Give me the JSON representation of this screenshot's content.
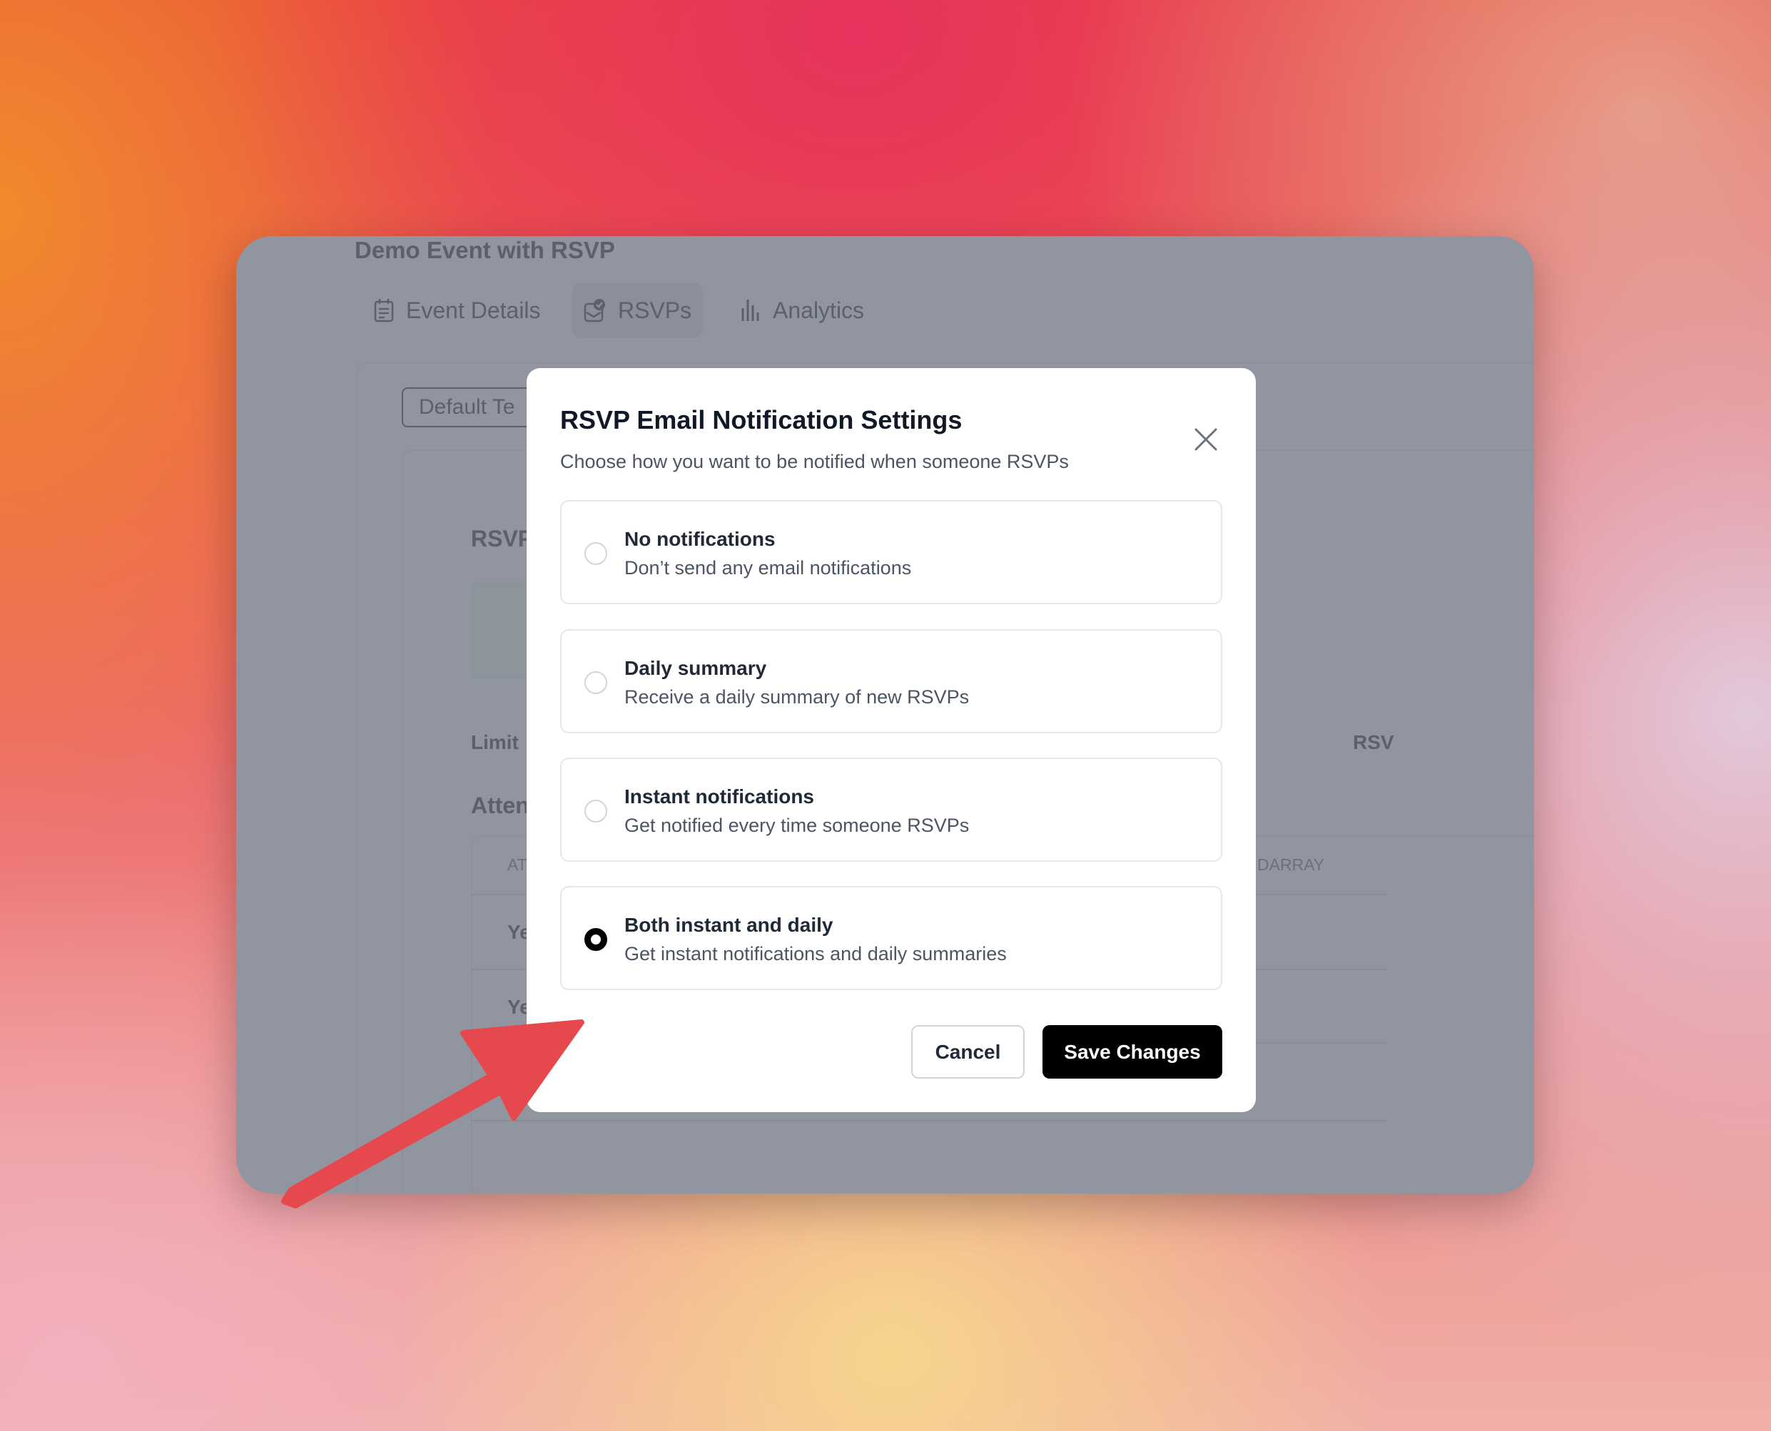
{
  "background_window": {
    "title": "Demo Event with RSVP",
    "tabs": [
      {
        "label": "Event Details",
        "icon": "calendar-icon",
        "active": false
      },
      {
        "label": "RSVPs",
        "icon": "rsvp-check-icon",
        "active": true
      },
      {
        "label": "Analytics",
        "icon": "bar-chart-icon",
        "active": false
      }
    ],
    "template_button": "Default Te",
    "section_heading": "RSVP",
    "limit_label": "Limit",
    "right_label": "RSV",
    "attendees_heading": "Atten",
    "table": {
      "headers": [
        "AT",
        "DARRAY"
      ],
      "rows": [
        "Ye",
        "Ye"
      ]
    }
  },
  "modal": {
    "title": "RSVP Email Notification Settings",
    "subtitle": "Choose how you want to be notified when someone RSVPs",
    "options": [
      {
        "title": "No notifications",
        "description": "Don’t send any email notifications",
        "selected": false
      },
      {
        "title": "Daily summary",
        "description": "Receive a daily summary of new RSVPs",
        "selected": false
      },
      {
        "title": "Instant notifications",
        "description": "Get notified every time someone RSVPs",
        "selected": false
      },
      {
        "title": "Both instant and daily",
        "description": "Get instant notifications and daily summaries",
        "selected": true
      }
    ],
    "cancel_label": "Cancel",
    "save_label": "Save Changes"
  },
  "colors": {
    "arrow": "#e5484d",
    "primary_button": "#000000",
    "overlay": "#91959f"
  }
}
